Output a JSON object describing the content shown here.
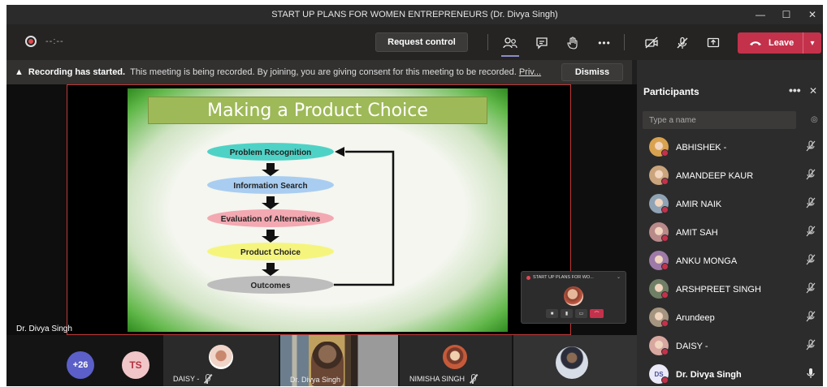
{
  "window": {
    "title": "START UP PLANS FOR WOMEN ENTREPRENEURS (Dr. Divya Singh)",
    "minimize": "—",
    "maximize": "☐",
    "close": "✕"
  },
  "toolbar": {
    "timer": "--:--",
    "request_control": "Request control",
    "more": "•••",
    "leave": "Leave"
  },
  "banner": {
    "strong": "Recording has started.",
    "text": "This meeting is being recorded. By joining, you are giving consent for this meeting to be recorded.",
    "link": "Priv...",
    "dismiss": "Dismiss"
  },
  "slide": {
    "title": "Making a Product Choice",
    "steps": [
      "Problem Recognition",
      "Information Search",
      "Evaluation of Alternatives",
      "Product Choice",
      "Outcomes"
    ],
    "colors": [
      "#4fd2c6",
      "#a9cdf1",
      "#f3a9b2",
      "#f5f57e",
      "#bdbdbd"
    ]
  },
  "stage": {
    "presenter": "Dr. Divya Singh"
  },
  "mini_window": {
    "title": "START UP PLANS FOR WO..."
  },
  "strip": {
    "overflow_count": "+26",
    "ts_initials": "TS",
    "tiles": [
      {
        "name": "DAISY -"
      },
      {
        "name": "Dr. Divya Singh"
      },
      {
        "name": "NIMISHA SINGH"
      }
    ]
  },
  "participants": {
    "title": "Participants",
    "more": "•••",
    "close": "✕",
    "search_placeholder": "Type a name",
    "list": [
      {
        "name": "ABHISHEK -",
        "color": "#d9a24e"
      },
      {
        "name": "AMANDEEP KAUR",
        "color": "#c9a47c"
      },
      {
        "name": "AMIR NAIK",
        "color": "#8fa3b5"
      },
      {
        "name": "AMIT SAH",
        "color": "#b98a8a"
      },
      {
        "name": "ANKU MONGA",
        "color": "#9d7aa8"
      },
      {
        "name": "ARSHPREET SINGH",
        "color": "#6f7f66"
      },
      {
        "name": "Arundeep",
        "color": "#a59480"
      },
      {
        "name": "DAISY -",
        "color": "#d7a7a0"
      },
      {
        "name": "Dr. Divya Singh",
        "initials": "DS"
      }
    ]
  }
}
